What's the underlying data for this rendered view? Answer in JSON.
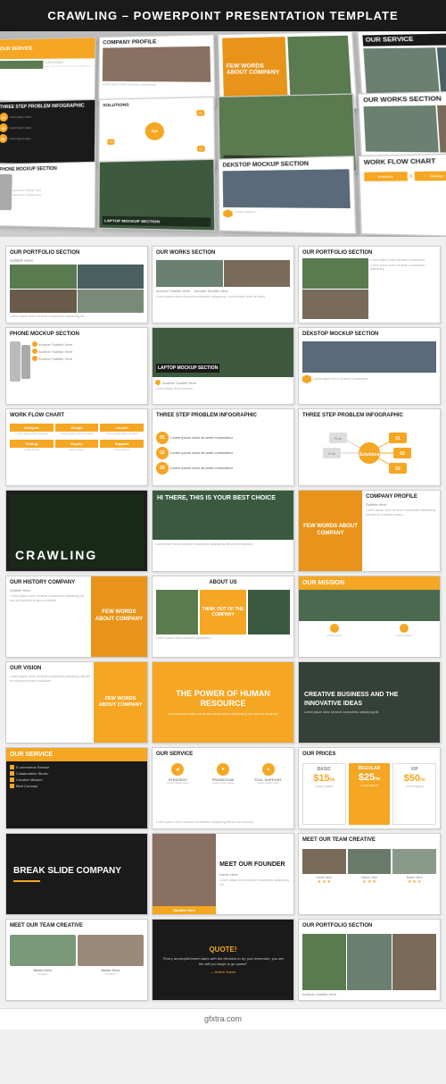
{
  "header": {
    "title": "CRAWLING – POWERPOINT PRESENTATION TEMPLATE"
  },
  "slides": {
    "row1": [
      {
        "id": "our-service-1",
        "title": "OUR SERVICE",
        "type": "orange-img",
        "imgClass": "forest-bg"
      },
      {
        "id": "company-profile-1",
        "title": "COMPANY PROFILE",
        "type": "text-right",
        "imgClass": "mountain-bg"
      },
      {
        "id": "our-service-2",
        "title": "OUR SERVICE",
        "type": "orange-img-right",
        "imgClass": "person-bg"
      }
    ],
    "row2": [
      {
        "id": "few-words-1",
        "title": "FEW WORDS ABOUT COMPANY",
        "type": "orange-box-center",
        "imgClass": "forest-bg"
      },
      {
        "id": "three-step-1",
        "title": "THREE STEP PROBLEM INFOGRAPHIC",
        "type": "dark-infographic"
      },
      {
        "id": "solutions-1",
        "title": "SOLUTIONS",
        "type": "mindmap"
      }
    ],
    "row3": [
      {
        "id": "portfolio-1",
        "title": "OUR PORTFOLIO SECTION",
        "type": "portfolio-grid",
        "imgClass": "forest-bg"
      },
      {
        "id": "works-1",
        "title": "OUR WORKS SECTION",
        "type": "works-grid"
      },
      {
        "id": "portfolio-2",
        "title": "OUR PORTFOLIO SECTION",
        "type": "portfolio-right",
        "imgClass": "mountain-bg"
      }
    ],
    "row4": [
      {
        "id": "phone-mock",
        "title": "PHONE MOCKUP SECTION",
        "type": "phone"
      },
      {
        "id": "laptop-mock",
        "title": "LAPTOP MOCKUP SECTION",
        "type": "laptop",
        "imgClass": "road-bg"
      },
      {
        "id": "desktop-mock",
        "title": "DEKSTOP MOCKUP SECTION",
        "type": "desktop"
      }
    ],
    "row5": [
      {
        "id": "workflow",
        "title": "WORK FLOW CHART",
        "type": "workflow"
      },
      {
        "id": "three-step-2",
        "title": "THREE STEP PROBLEM INFOGRAPHIC",
        "type": "infographic-light"
      },
      {
        "id": "three-step-3",
        "title": "THREE STEP PROBLEM INFOGRAPHIC",
        "type": "infographic-orange"
      }
    ],
    "row6": [
      {
        "id": "crawling-dark",
        "title": "CRAWLING",
        "type": "dark-title",
        "imgClass": "dark-forest-bg"
      },
      {
        "id": "hi-there",
        "title": "HI THERE, THIS IS YOUR BEST CHOICE",
        "type": "hiker-text",
        "imgClass": "hiker-bg"
      },
      {
        "id": "company-profile-2",
        "title": "COMPANY PROFILE",
        "type": "orange-img-left",
        "imgClass": "amber-bg"
      }
    ],
    "row7": [
      {
        "id": "our-history",
        "title": "OUR HISTORY COMPANY",
        "type": "history",
        "imgClass": "amber-bg"
      },
      {
        "id": "about-us",
        "title": "ABOUT US",
        "type": "about"
      },
      {
        "id": "our-mission",
        "title": "OUR MISSION",
        "type": "mission",
        "imgClass": "forest-bg"
      }
    ],
    "row8": [
      {
        "id": "our-vision",
        "title": "OUR VISION",
        "type": "vision"
      },
      {
        "id": "power-hr",
        "title": "THE POWER OF HUMAN RESOURCE",
        "type": "dark-orange-text"
      },
      {
        "id": "creative-biz",
        "title": "CREATIVE BUSINESS AND THE INNOVATIVE IDEAS",
        "type": "creative",
        "imgClass": "mountain-bg"
      }
    ],
    "row9": [
      {
        "id": "our-service-dark",
        "title": "OUR SERVICE",
        "type": "service-dark"
      },
      {
        "id": "our-service-list",
        "title": "OUR SERVICE",
        "type": "service-list"
      },
      {
        "id": "our-prices",
        "title": "OUR PRICES",
        "type": "prices"
      }
    ],
    "row10": [
      {
        "id": "break-slide",
        "title": "BREAK SLIDE COMPANY",
        "type": "break-dark"
      },
      {
        "id": "meet-founder",
        "title": "MEET OUR FOUNDER",
        "type": "founder",
        "imgClass": "person-bg"
      },
      {
        "id": "meet-team-1",
        "title": "MEET OUR TEAM CREATIVE",
        "type": "team-grid"
      }
    ],
    "row11": [
      {
        "id": "meet-team-2",
        "title": "MEET OUR TEAM CREATIVE",
        "type": "team-photos"
      },
      {
        "id": "quote",
        "title": "QUOTE!",
        "type": "quote-dark"
      },
      {
        "id": "portfolio-3",
        "title": "OUR PORTFOLIO SECTION",
        "type": "portfolio-bottom",
        "imgClass": "forest-bg"
      }
    ]
  },
  "watermark": {
    "text": "gfxtra.com"
  },
  "colors": {
    "orange": "#f5a623",
    "dark": "#1e1e1e",
    "white": "#ffffff",
    "lightGrey": "#f0f0f0",
    "medGrey": "#999999"
  }
}
